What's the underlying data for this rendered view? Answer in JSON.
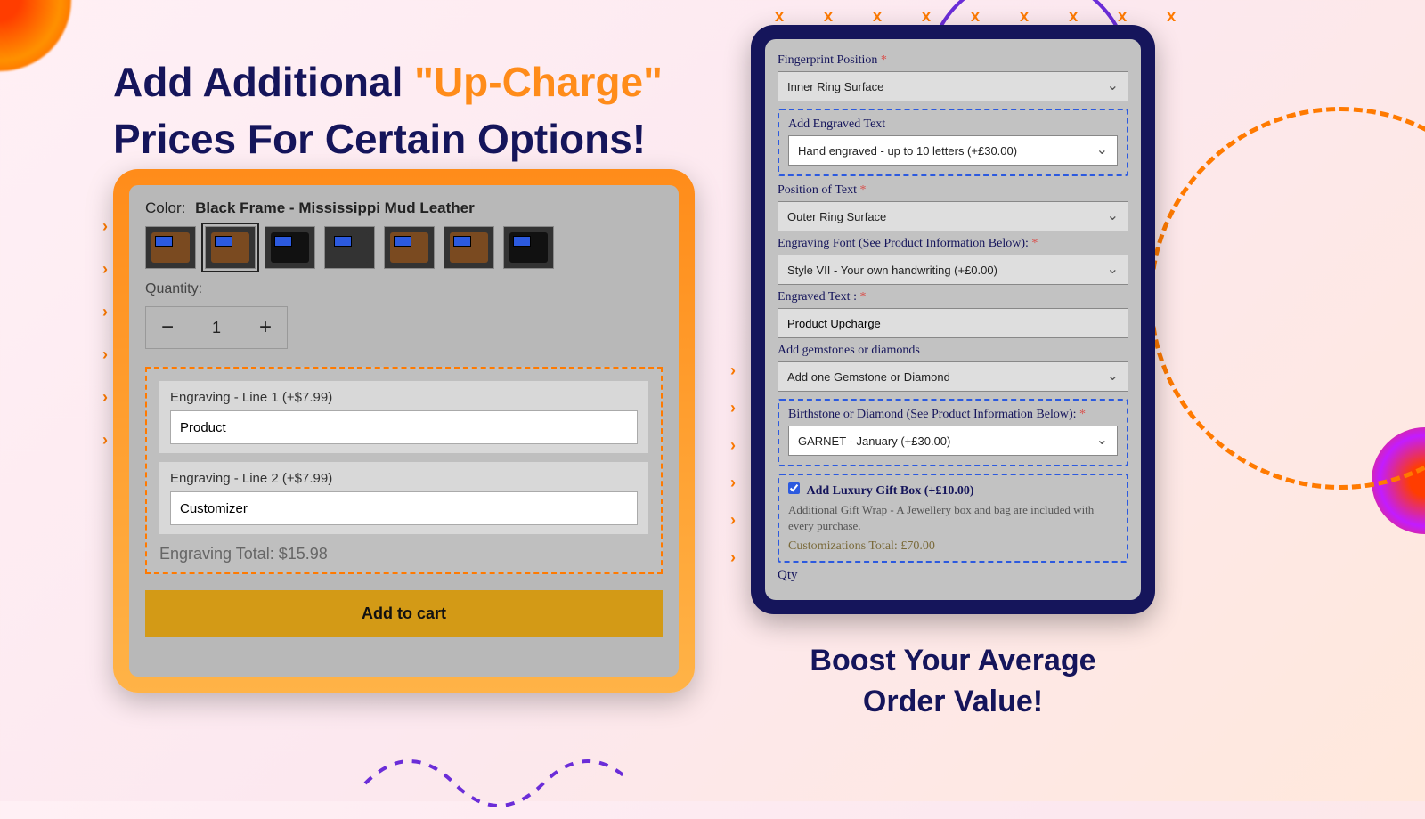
{
  "headline": {
    "part1": "Add Additional ",
    "accent": "\"Up-Charge\"",
    "part2": "Prices For Certain Options!"
  },
  "left": {
    "color_label": "Color:",
    "color_value": "Black Frame - Mississippi Mud Leather",
    "quantity_label": "Quantity:",
    "quantity_value": "1",
    "minus": "−",
    "plus": "+",
    "engraving": {
      "line1_label": "Engraving - Line 1 (+$7.99)",
      "line1_value": "Product",
      "line2_label": "Engraving - Line 2 (+$7.99)",
      "line2_value": "Customizer",
      "total": "Engraving Total: $15.98"
    },
    "add_to_cart": "Add to cart"
  },
  "right": {
    "fingerprint_label": "Fingerprint Position",
    "fingerprint_value": "Inner Ring Surface",
    "engraved_text_label": "Add Engraved Text",
    "engraved_text_value": "Hand engraved - up to 10 letters (+£30.00)",
    "position_label": "Position of Text",
    "position_value": "Outer Ring Surface",
    "font_label": "Engraving Font (See Product Information Below):",
    "font_value": "Style VII - Your own handwriting (+£0.00)",
    "engraved_input_label": "Engraved Text :",
    "engraved_input_value": "Product Upcharge",
    "gems_label": "Add gemstones or diamonds",
    "gems_value": "Add one Gemstone or Diamond",
    "birthstone_label": "Birthstone or Diamond (See Product Information Below):",
    "birthstone_value": "GARNET - January (+£30.00)",
    "giftbox_label": "Add Luxury Gift Box (+£10.00)",
    "giftbox_sub": "Additional Gift Wrap - A Jewellery box and bag are included with every purchase.",
    "cust_total": "Customizations Total: £70.00",
    "qty": "Qty"
  },
  "tagline": {
    "line1": "Boost Your Average",
    "line2": "Order Value!"
  }
}
